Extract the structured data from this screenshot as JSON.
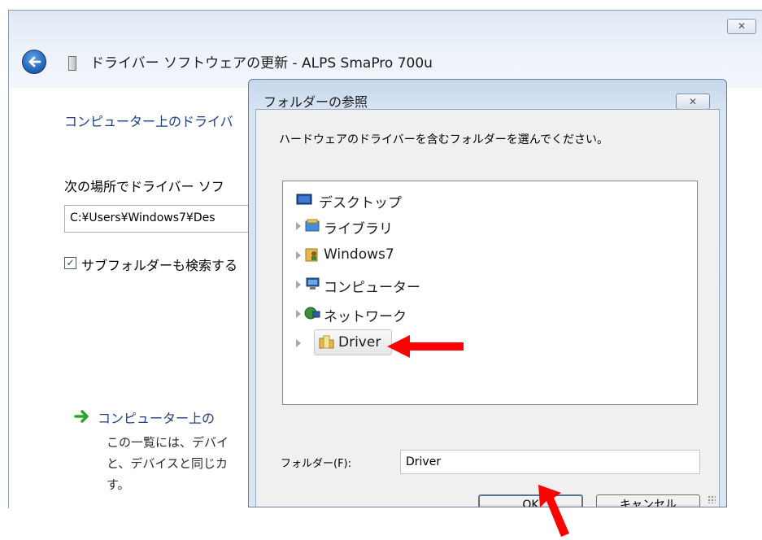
{
  "main_window": {
    "title": "ドライバー ソフトウェアの更新 - ALPS SmaPro 700u",
    "close_glyph": "✕",
    "heading": "コンピューター上のドライバ",
    "location_label": "次の場所でドライバー ソフ",
    "path_value": "C:¥Users¥Windows7¥Des",
    "subfolder_checked": true,
    "subfolder_label": "サブフォルダーも検索する",
    "pick_link_title": "コンピューター上の",
    "description_lines": [
      "この一覧には、デバイ",
      "と、デバイスと同じカ",
      "す。"
    ]
  },
  "browse_dialog": {
    "title": "フォルダーの参照",
    "close_glyph": "✕",
    "instruction": "ハードウェアのドライバーを含むフォルダーを選んでください。",
    "tree": [
      {
        "label": "デスクトップ",
        "icon": "desktop-icon",
        "expandable": false
      },
      {
        "label": "ライブラリ",
        "icon": "library-icon",
        "expandable": true
      },
      {
        "label": "Windows7",
        "icon": "user-folder-icon",
        "expandable": true
      },
      {
        "label": "コンピューター",
        "icon": "computer-icon",
        "expandable": true
      },
      {
        "label": "ネットワーク",
        "icon": "network-icon",
        "expandable": true
      },
      {
        "label": "Driver",
        "icon": "folder-icon",
        "expandable": true,
        "selected": true
      }
    ],
    "folder_label": "フォルダー(F):",
    "folder_value": "Driver",
    "ok_label": "OK",
    "cancel_label": "キャンセル"
  },
  "colors": {
    "annotation_arrow": "#ff0000",
    "link_blue": "#1e3f8a"
  }
}
